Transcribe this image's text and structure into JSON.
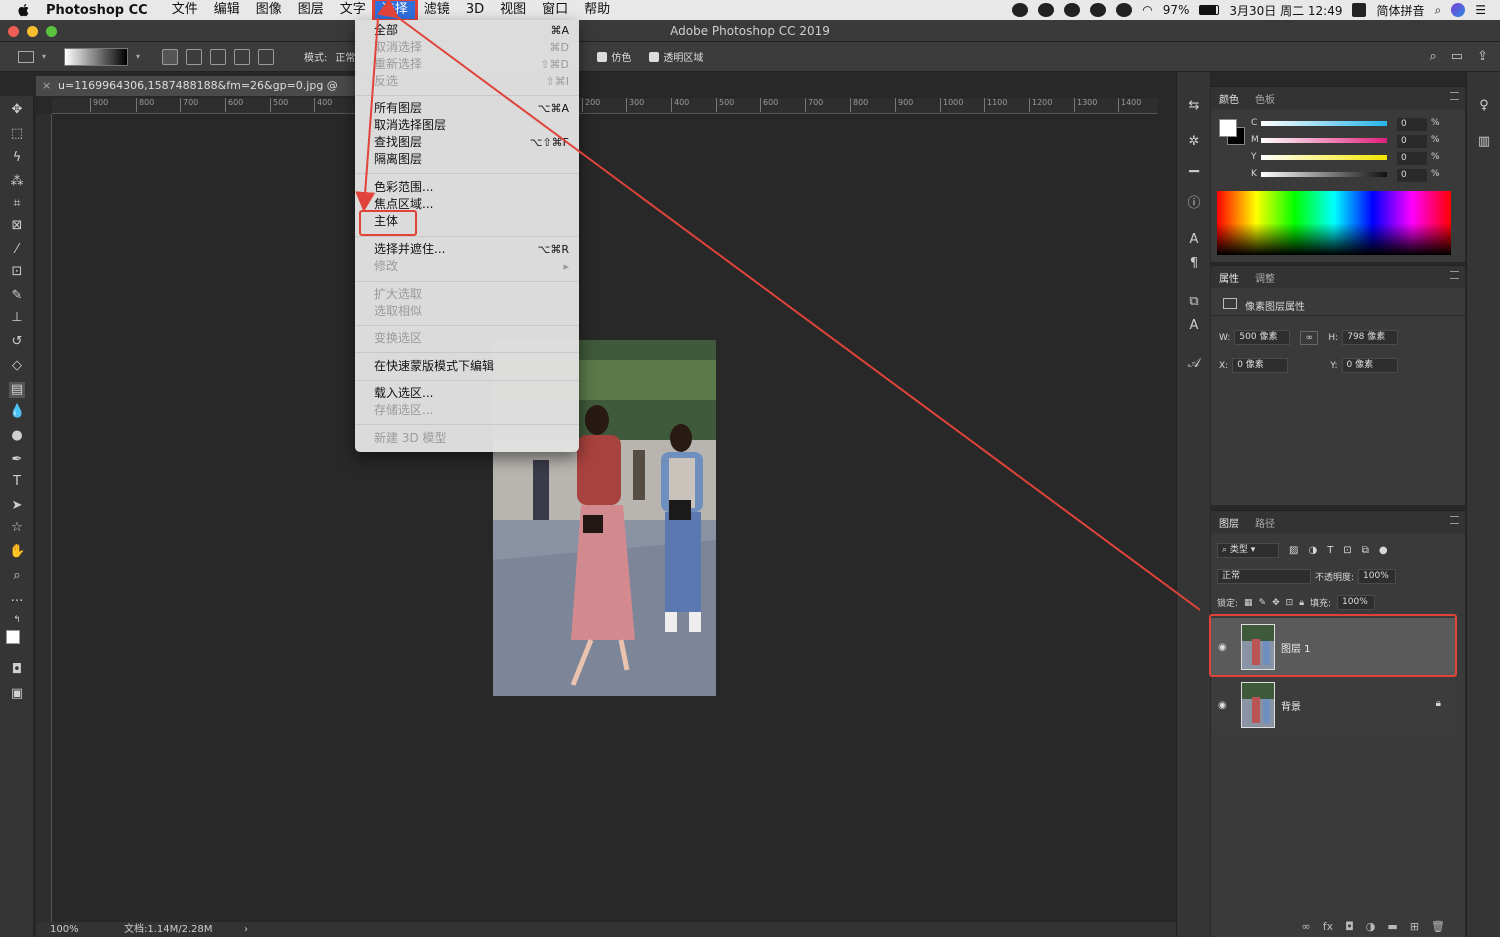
{
  "menubar": {
    "app_name": "Photoshop CC",
    "items": [
      "文件",
      "编辑",
      "图像",
      "图层",
      "文字",
      "选择",
      "滤镜",
      "3D",
      "视图",
      "窗口",
      "帮助"
    ],
    "battery": "97%",
    "datetime": "3月30日 周二  12:49",
    "input_method": "简体拼音"
  },
  "titlebar": {
    "title": "Adobe Photoshop CC 2019"
  },
  "options": {
    "mode_label": "模式:",
    "mode_value": "正常",
    "dither": "仿色",
    "transparency": "透明区域"
  },
  "document": {
    "tab_title": "u=1169964306,1587488188&fm=26&gp=0.jpg @ 100%",
    "zoom": "100%",
    "doc_info": "文档:1.14M/2.28M"
  },
  "rulers": {
    "left_ticks": [
      "900",
      "800",
      "700",
      "600",
      "500",
      "400"
    ],
    "right_ticks": [
      "200",
      "300",
      "400",
      "500",
      "600",
      "700",
      "800",
      "900",
      "1000",
      "1100",
      "1200",
      "1300",
      "1400"
    ]
  },
  "select_menu": {
    "groups": [
      [
        {
          "label": "全部",
          "shortcut": "⌘A",
          "enabled": true
        },
        {
          "label": "取消选择",
          "shortcut": "⌘D",
          "enabled": false
        },
        {
          "label": "重新选择",
          "shortcut": "⇧⌘D",
          "enabled": false
        },
        {
          "label": "反选",
          "shortcut": "⇧⌘I",
          "enabled": false
        }
      ],
      [
        {
          "label": "所有图层",
          "shortcut": "⌥⌘A",
          "enabled": true
        },
        {
          "label": "取消选择图层",
          "shortcut": "",
          "enabled": true
        },
        {
          "label": "查找图层",
          "shortcut": "⌥⇧⌘F",
          "enabled": true
        },
        {
          "label": "隔离图层",
          "shortcut": "",
          "enabled": true
        }
      ],
      [
        {
          "label": "色彩范围...",
          "shortcut": "",
          "enabled": true
        },
        {
          "label": "焦点区域...",
          "shortcut": "",
          "enabled": true
        },
        {
          "label": "主体",
          "shortcut": "",
          "enabled": true
        }
      ],
      [
        {
          "label": "选择并遮住...",
          "shortcut": "⌥⌘R",
          "enabled": true
        },
        {
          "label": "修改",
          "shortcut": "▸",
          "enabled": false
        }
      ],
      [
        {
          "label": "扩大选取",
          "shortcut": "",
          "enabled": false
        },
        {
          "label": "选取相似",
          "shortcut": "",
          "enabled": false
        }
      ],
      [
        {
          "label": "变换选区",
          "shortcut": "",
          "enabled": false
        }
      ],
      [
        {
          "label": "在快速蒙版模式下编辑",
          "shortcut": "",
          "enabled": true
        }
      ],
      [
        {
          "label": "载入选区...",
          "shortcut": "",
          "enabled": true
        },
        {
          "label": "存储选区...",
          "shortcut": "",
          "enabled": false
        }
      ],
      [
        {
          "label": "新建 3D 模型",
          "shortcut": "",
          "enabled": false
        }
      ]
    ]
  },
  "color_panel": {
    "tabs": [
      "颜色",
      "色板"
    ],
    "channels": [
      {
        "label": "C",
        "value": "0",
        "unit": "%"
      },
      {
        "label": "M",
        "value": "0",
        "unit": "%"
      },
      {
        "label": "Y",
        "value": "0",
        "unit": "%"
      },
      {
        "label": "K",
        "value": "0",
        "unit": "%"
      }
    ]
  },
  "properties_panel": {
    "tabs": [
      "属性",
      "调整"
    ],
    "heading": "像素图层属性",
    "w_label": "W:",
    "w_value": "500 像素",
    "h_label": "H:",
    "h_value": "798 像素",
    "x_label": "X:",
    "x_value": "0 像素",
    "y_label": "Y:",
    "y_value": "0 像素"
  },
  "layers_panel": {
    "tabs": [
      "图层",
      "路径"
    ],
    "filter_label": "类型",
    "blend_mode": "正常",
    "opacity_label": "不透明度:",
    "opacity_value": "100%",
    "lock_label": "锁定:",
    "fill_label": "填充:",
    "fill_value": "100%",
    "layers": [
      {
        "name": "图层 1",
        "selected": true,
        "locked": false
      },
      {
        "name": "背景",
        "selected": false,
        "locked": true
      }
    ]
  },
  "colors": {
    "accent_red": "#e0433a",
    "menu_highlight": "#2f6fde"
  }
}
